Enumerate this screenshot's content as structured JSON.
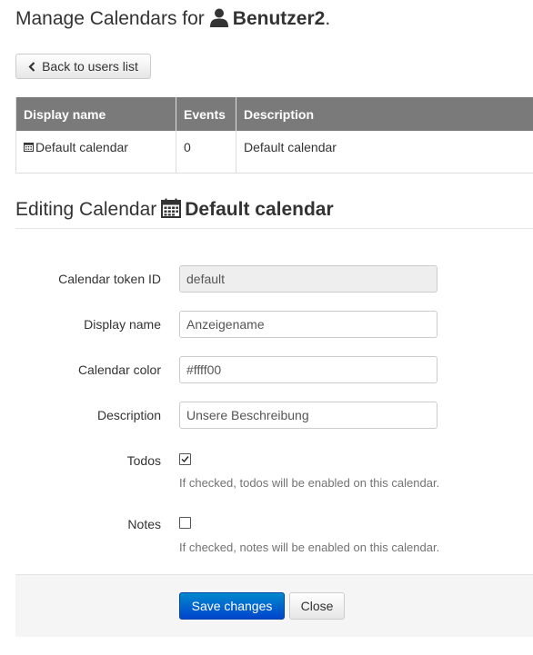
{
  "header": {
    "title_prefix": "Manage Calendars for",
    "username": "Benutzer2",
    "title_suffix": ".",
    "user_icon": "user-icon"
  },
  "back_button": {
    "label": "Back to users list",
    "icon": "chevron-left-icon"
  },
  "calendars_table": {
    "columns": [
      "Display name",
      "Events",
      "Description"
    ],
    "rows": [
      {
        "display_name": "Default calendar",
        "events": "0",
        "description": "Default calendar",
        "icon": "calendar-icon"
      }
    ]
  },
  "edit_section": {
    "heading_prefix": "Editing Calendar",
    "calendar_name": "Default calendar",
    "icon": "calendar-icon"
  },
  "form": {
    "token_id": {
      "label": "Calendar token ID",
      "value": "default",
      "readonly": true
    },
    "display_name": {
      "label": "Display name",
      "value": "Anzeigename"
    },
    "color": {
      "label": "Calendar color",
      "value": "#ffff00"
    },
    "description": {
      "label": "Description",
      "value": "Unsere Beschreibung"
    },
    "todos": {
      "label": "Todos",
      "checked": true,
      "help": "If checked, todos will be enabled on this calendar."
    },
    "notes": {
      "label": "Notes",
      "checked": false,
      "help": "If checked, notes will be enabled on this calendar."
    }
  },
  "actions": {
    "save_label": "Save changes",
    "close_label": "Close"
  },
  "colors": {
    "primary": "#0055cc",
    "table_header": "#7a7a7a",
    "readonly_bg": "#eeeeee"
  }
}
